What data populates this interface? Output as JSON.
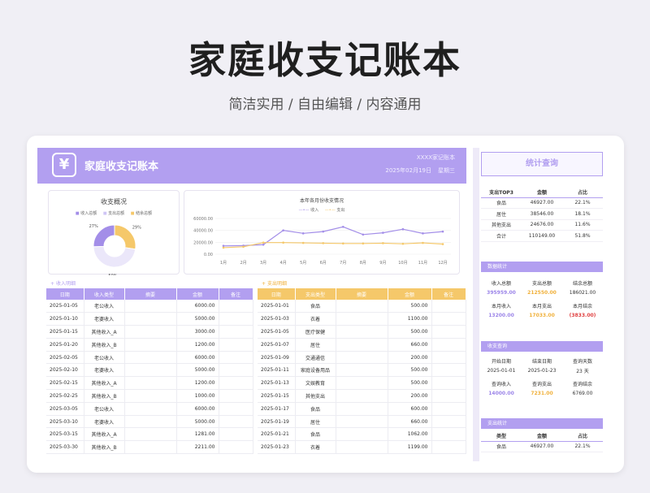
{
  "hero": {
    "title": "家庭收支记账本",
    "subtitle": "简洁实用 / 自由编辑 / 内容通用"
  },
  "banner": {
    "logo": "¥",
    "title": "家庭收支记账本",
    "org": "XXXX家记账本",
    "date": "2025年02月19日",
    "weekday": "星期三"
  },
  "query_title": "统计查询",
  "overview": {
    "title": "收支概况",
    "legend": [
      "收入总额",
      "支出总额",
      "结余总额"
    ],
    "pie": [
      {
        "label": "29%",
        "value": 29,
        "color": "#f5c86a"
      },
      {
        "label": "50%",
        "value": 50,
        "color": "#ebe7fa"
      },
      {
        "label": "27%",
        "value": 27,
        "color": "#a38ee8"
      }
    ]
  },
  "chart_data": {
    "type": "line",
    "title": "本年各月份收支情况",
    "categories": [
      "1月",
      "2月",
      "3月",
      "4月",
      "5月",
      "6月",
      "7月",
      "8月",
      "9月",
      "10月",
      "11月",
      "12月"
    ],
    "series": [
      {
        "name": "收入",
        "color": "#a38ee8",
        "values": [
          14000,
          14500,
          16000,
          40000,
          35000,
          38000,
          46000,
          33000,
          36000,
          42000,
          35000,
          38000
        ]
      },
      {
        "name": "支出",
        "color": "#f5c86a",
        "values": [
          11000,
          12500,
          19500,
          19500,
          19000,
          18500,
          18000,
          18000,
          18500,
          17500,
          19000,
          17000
        ]
      }
    ],
    "yticks": [
      "60000.00",
      "40000.00",
      "20000.00",
      "0.00"
    ],
    "ylim": [
      0,
      60000
    ]
  },
  "income": {
    "label": "收入明细",
    "headers": [
      "日期",
      "收入类型",
      "摘要",
      "金额",
      "备注"
    ],
    "rows": [
      [
        "2025-01-05",
        "老公收入",
        "",
        "6000.00",
        ""
      ],
      [
        "2025-01-10",
        "老婆收入",
        "",
        "5000.00",
        ""
      ],
      [
        "2025-01-15",
        "其他收入_A",
        "",
        "3000.00",
        ""
      ],
      [
        "2025-01-20",
        "其他收入_B",
        "",
        "1200.00",
        ""
      ],
      [
        "2025-02-05",
        "老公收入",
        "",
        "6000.00",
        ""
      ],
      [
        "2025-02-10",
        "老婆收入",
        "",
        "5000.00",
        ""
      ],
      [
        "2025-02-15",
        "其他收入_A",
        "",
        "1200.00",
        ""
      ],
      [
        "2025-02-25",
        "其他收入_B",
        "",
        "1000.00",
        ""
      ],
      [
        "2025-03-05",
        "老公收入",
        "",
        "6000.00",
        ""
      ],
      [
        "2025-03-10",
        "老婆收入",
        "",
        "5000.00",
        ""
      ],
      [
        "2025-03-15",
        "其他收入_A",
        "",
        "1281.00",
        ""
      ],
      [
        "2025-03-30",
        "其他收入_B",
        "",
        "2211.00",
        ""
      ]
    ]
  },
  "expense": {
    "label": "支出明细",
    "headers": [
      "日期",
      "支出类型",
      "摘要",
      "金额",
      "备注"
    ],
    "rows": [
      [
        "2025-01-01",
        "食品",
        "",
        "500.00",
        ""
      ],
      [
        "2025-01-03",
        "衣着",
        "",
        "1100.00",
        ""
      ],
      [
        "2025-01-05",
        "医疗保健",
        "",
        "500.00",
        ""
      ],
      [
        "2025-01-07",
        "居住",
        "",
        "660.00",
        ""
      ],
      [
        "2025-01-09",
        "交通通信",
        "",
        "200.00",
        ""
      ],
      [
        "2025-01-11",
        "家庭设备用品",
        "",
        "500.00",
        ""
      ],
      [
        "2025-01-13",
        "文娱教育",
        "",
        "500.00",
        ""
      ],
      [
        "2025-01-15",
        "其他支出",
        "",
        "200.00",
        ""
      ],
      [
        "2025-01-17",
        "食品",
        "",
        "600.00",
        ""
      ],
      [
        "2025-01-19",
        "居住",
        "",
        "660.00",
        ""
      ],
      [
        "2025-01-21",
        "食品",
        "",
        "1062.00",
        ""
      ],
      [
        "2025-01-23",
        "衣着",
        "",
        "1199.00",
        ""
      ]
    ]
  },
  "top3": {
    "headers": [
      "支出TOP3",
      "金额",
      "占比"
    ],
    "rows": [
      [
        "食品",
        "46927.00",
        "22.1%"
      ],
      [
        "居住",
        "38546.00",
        "18.1%"
      ],
      [
        "其他支出",
        "24676.00",
        "11.6%"
      ],
      [
        "合计",
        "110149.00",
        "51.8%"
      ]
    ]
  },
  "stats": {
    "title": "数据统计",
    "h1": [
      "收入总额",
      "支出总额",
      "结余总额"
    ],
    "v1": [
      "395959.00",
      "212550.00",
      "186021.00"
    ],
    "h2": [
      "本月收入",
      "本月支出",
      "本月结余"
    ],
    "v2": [
      "13200.00",
      "17033.00",
      "(3833.00)"
    ]
  },
  "query": {
    "title": "收支查询",
    "h1": [
      "开始日期",
      "结束日期",
      "查询天数"
    ],
    "v1": [
      "2025-01-01",
      "2025-01-23",
      "23 天"
    ],
    "h2": [
      "查询收入",
      "查询支出",
      "查询结余"
    ],
    "v2": [
      "14000.00",
      "7231.00",
      "6769.00"
    ]
  },
  "spend": {
    "title": "支出统计",
    "headers": [
      "类型",
      "金额",
      "占比"
    ],
    "row": [
      "食品",
      "46927.00",
      "22.1%"
    ]
  }
}
